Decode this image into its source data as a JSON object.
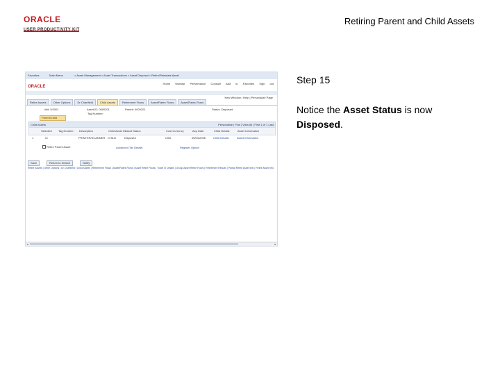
{
  "brand": {
    "name": "ORACLE",
    "subtitle": "USER PRODUCTIVITY KIT"
  },
  "document": {
    "title": "Retiring Parent and Child Assets"
  },
  "step": {
    "label": "Step 15"
  },
  "instruction": {
    "prefix": "Notice the ",
    "field": "Asset Status",
    "middle": " is now ",
    "value": "Disposed",
    "suffix": "."
  },
  "screenshot": {
    "breadcrumb_left": "Favorites",
    "breadcrumb_main": "Main Menu",
    "breadcrumb_path": "> Asset Management > Asset Transactions > Asset Disposal > Retire/Reinstate Asset",
    "logo": "ORACLE",
    "nav_links": "Home   Worklist   Performance Console   Add to Favorites   Sign out",
    "new_window": "New Window | Help | Personalize Page",
    "tabs": [
      "Retire Assets",
      "Other Options",
      "Dr Chartfield",
      "Child Assets",
      "Retirement Flows",
      "Asset/Rates Flows",
      "Asset/Rates Flows"
    ],
    "active_tab": 3,
    "unit_label": "Unit: US001",
    "asset_label": "Asset ID: 0000201",
    "parent_label": "Parent: 0000201",
    "status_label": "Status: Disposed",
    "tag_label": "Tag Number:",
    "pill": "Parent/Child",
    "grid_title": "Child Assets",
    "grid_controls": "Personalize | Find | View All |   First 1 of 1 Last",
    "columns": [
      "Selected",
      "Tag Number",
      "Description",
      "Child Asset ID",
      "Asset Status",
      "Cost Currency",
      "Acq Date",
      "Child Details",
      "Asset Information"
    ],
    "row": [
      "1",
      "☑",
      "PRINTER/SCANNER",
      "CHILD",
      "Disposed",
      "USD",
      "05/03/2006",
      "Child Details",
      "Asset Information"
    ],
    "retire_parent": "Retire Parent Asset",
    "adv_link": "Advanced Tax Details",
    "register_link": "Register Option",
    "buttons": [
      "Save",
      "Return to Search",
      "Notify"
    ],
    "footer_links": "Retire Assets | Other Options | Dr Chartfield | Child Assets | Retirement Flows | Asset/Rates Flows | Asset Retire Flows | Trade In Details | Group Asset Retire Flows | Retirement Results | Partial Retire Asset Info | Retire Asset Info"
  }
}
